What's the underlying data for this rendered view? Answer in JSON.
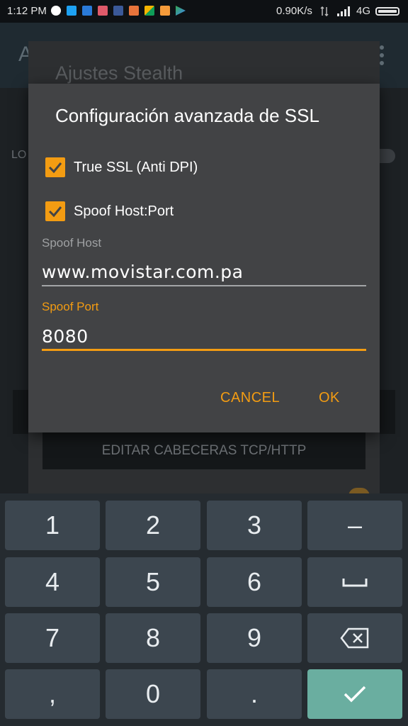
{
  "status_bar": {
    "time": "1:12 PM",
    "notification_icons": [
      "google-icon",
      "twitter-icon",
      "app-icon",
      "instagram-icon",
      "facebook-icon",
      "app-icon",
      "pinwheel-icon",
      "mail-icon",
      "play-store-icon"
    ],
    "net_speed": "0.90K/s",
    "network": "4G"
  },
  "background": {
    "app_title_fragment": "A",
    "dialog_title": "Ajustes Stealth",
    "row_label": "LO",
    "edit_button": "EDITAR CABECERAS TCP/HTTP"
  },
  "dialog": {
    "title": "Configuración avanzada de SSL",
    "checkbox_true_ssl": {
      "label": "True SSL (Anti DPI)",
      "checked": true
    },
    "checkbox_spoof": {
      "label": "Spoof Host:Port",
      "checked": true
    },
    "spoof_host_label": "Spoof Host",
    "spoof_host_value": "www.movistar.com.pa",
    "spoof_port_label": "Spoof Port",
    "spoof_port_value": "8080",
    "cancel_label": "CANCEL",
    "ok_label": "OK"
  },
  "keyboard": {
    "keys": [
      "1",
      "2",
      "3",
      "–",
      "4",
      "5",
      "6",
      "⎵",
      "7",
      "8",
      "9",
      "⌫",
      ",",
      "0",
      ".",
      "✓"
    ]
  },
  "colors": {
    "accent": "#f39c12",
    "confirm_key": "#6aaea0",
    "key_bg": "#3c464f"
  }
}
